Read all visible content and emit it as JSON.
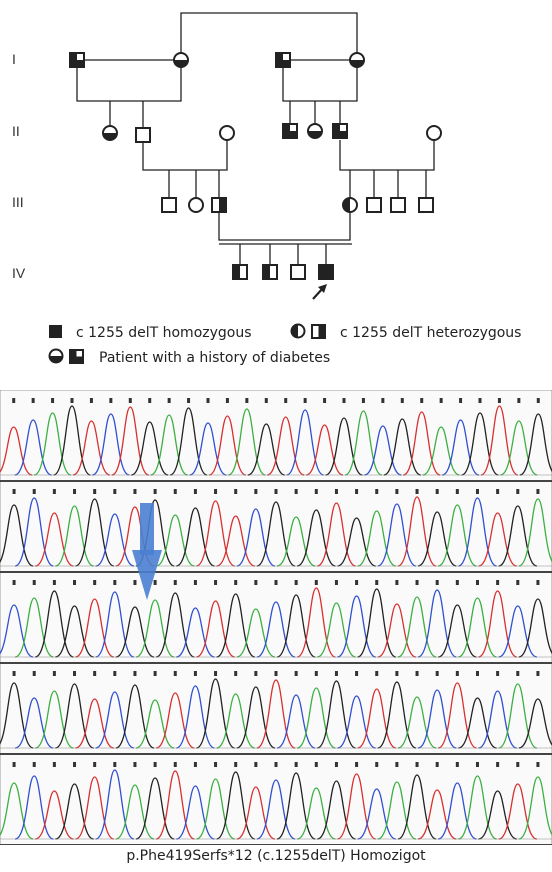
{
  "pedigree": {
    "generation_labels": [
      "I",
      "II",
      "III",
      "IV"
    ]
  },
  "legend": {
    "homozygous": "c 1255 delT homozygous",
    "heterozygous": "c 1255 delT heterozygous",
    "diabetes": "Patient with a history of diabetes"
  },
  "chromatogram": {
    "caption": "p.Phe419Serfs*12 (c.1255delT) Homozigot",
    "trace_colors": {
      "A": "#3cb043",
      "C": "#3050d0",
      "G": "#222222",
      "T": "#d83030"
    },
    "arrow_color": "#4a7fd0",
    "rows": [
      {
        "bases": [
          "T",
          "C",
          "A",
          "G",
          "T",
          "C",
          "T",
          "G",
          "A",
          "G",
          "C",
          "T",
          "A",
          "G",
          "T",
          "C",
          "T",
          "G",
          "A",
          "C",
          "G",
          "T",
          "A",
          "C",
          "G",
          "T",
          "A",
          "G"
        ]
      },
      {
        "bases": [
          "G",
          "C",
          "T",
          "A",
          "G",
          "C",
          "T",
          "G",
          "A",
          "G",
          "T",
          "T",
          "C",
          "G",
          "A",
          "G",
          "T",
          "G",
          "A",
          "C",
          "T",
          "G",
          "A",
          "C",
          "T",
          "G",
          "A"
        ]
      },
      {
        "bases": [
          "C",
          "A",
          "G",
          "G",
          "T",
          "C",
          "G",
          "A",
          "G",
          "C",
          "T",
          "G",
          "A",
          "C",
          "G",
          "T",
          "A",
          "C",
          "G",
          "T",
          "A",
          "C",
          "G",
          "A",
          "T",
          "C",
          "G"
        ]
      },
      {
        "bases": [
          "G",
          "C",
          "A",
          "G",
          "T",
          "C",
          "G",
          "A",
          "T",
          "C",
          "G",
          "A",
          "G",
          "T",
          "C",
          "A",
          "G",
          "C",
          "T",
          "G",
          "A",
          "C",
          "T",
          "G",
          "C",
          "A",
          "G"
        ]
      },
      {
        "bases": [
          "A",
          "C",
          "T",
          "G",
          "T",
          "C",
          "A",
          "G",
          "T",
          "C",
          "A",
          "G",
          "T",
          "C",
          "G",
          "A",
          "G",
          "T",
          "C",
          "A",
          "G",
          "T",
          "C",
          "A",
          "G",
          "T",
          "A"
        ]
      }
    ]
  }
}
